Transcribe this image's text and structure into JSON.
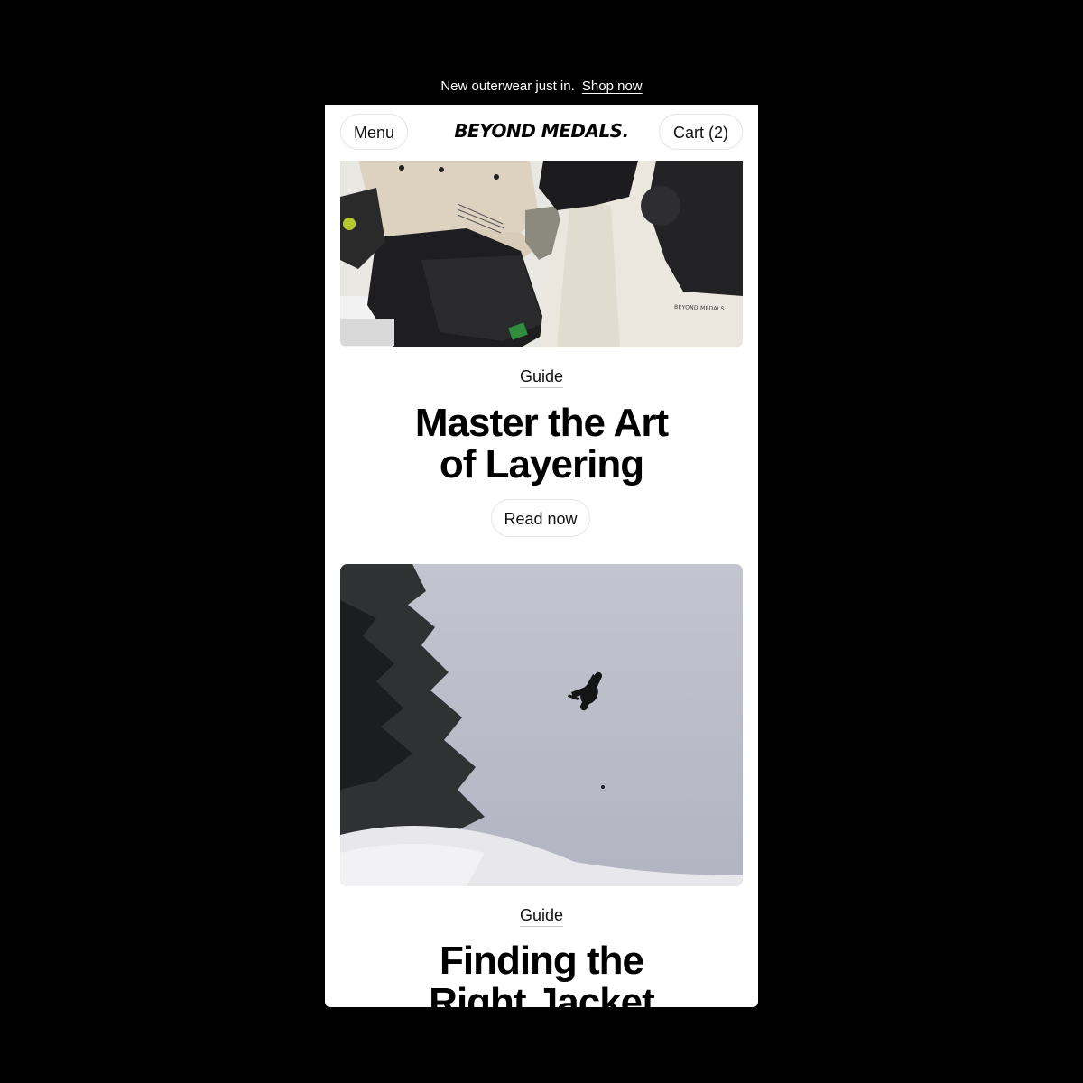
{
  "announcement": {
    "text": "New outerwear just in.",
    "link_label": "Shop now"
  },
  "header": {
    "menu_label": "Menu",
    "logo_text": "BEYOND MEDALS.",
    "cart_label": "Cart (2)"
  },
  "articles": [
    {
      "category": "Guide",
      "title_line1": "Master the Art",
      "title_line2": "of Layering",
      "cta_label": "Read now",
      "image_alt": "Riders in beige jackets sitting in snow",
      "image_print": "BEYOND MEDALS"
    },
    {
      "category": "Guide",
      "title_line1": "Finding the",
      "title_line2": "Right Jacket",
      "image_alt": "Snowboarder jumping against grey sky beside trees"
    }
  ],
  "colors": {
    "background": "#000000",
    "page": "#ffffff",
    "text": "#111111",
    "pill_border": "#e4e4e4"
  }
}
